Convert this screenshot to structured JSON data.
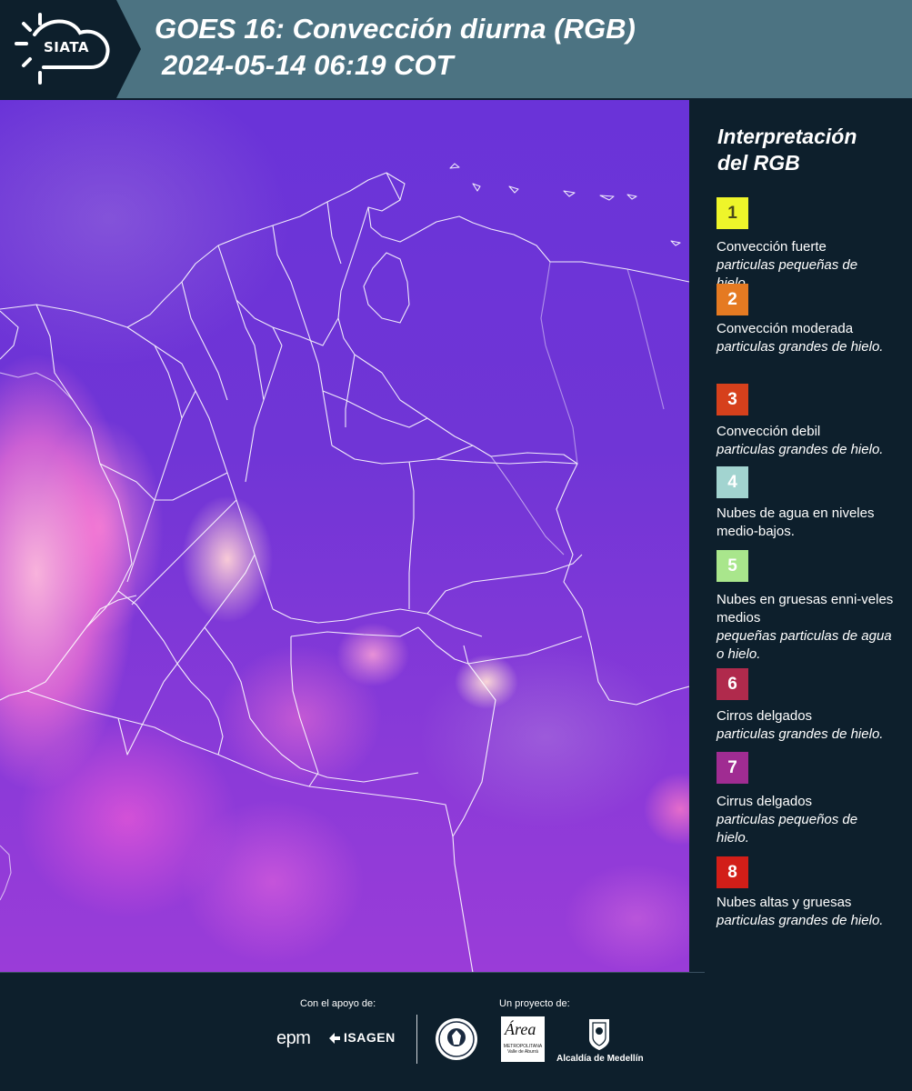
{
  "header": {
    "logo_text": "SIATA",
    "title_line1": "GOES 16: Convección diurna (RGB)",
    "title_line2": "2024-05-14 06:19 COT"
  },
  "legend": {
    "title_line1": "Interpretación",
    "title_line2": "del RGB",
    "items": [
      {
        "number": "1",
        "color": "#eef52a",
        "text_color": "#4a4a1a",
        "label": "Convección fuerte",
        "detail": "particulas pequeñas de hielo."
      },
      {
        "number": "2",
        "color": "#e57a22",
        "text_color": "#ffffff",
        "label": "Convección moderada",
        "detail": "particulas grandes de hielo."
      },
      {
        "number": "3",
        "color": "#d6401c",
        "text_color": "#ffffff",
        "label": "Convección debil",
        "detail": "particulas grandes de hielo."
      },
      {
        "number": "4",
        "color": "#a2d4d0",
        "text_color": "#ffffff",
        "label": "Nubes de agua en niveles medio-bajos.",
        "detail": ""
      },
      {
        "number": "5",
        "color": "#a9e68c",
        "text_color": "#ffffff",
        "label": "Nubes en gruesas enni-veles medios",
        "detail": "pequeñas particulas de agua o hielo."
      },
      {
        "number": "6",
        "color": "#b02a4c",
        "text_color": "#ffffff",
        "label": "Cirros delgados",
        "detail": "particulas grandes de hielo."
      },
      {
        "number": "7",
        "color": "#a02c92",
        "text_color": "#ffffff",
        "label": "Cirrus delgados",
        "detail": "particulas pequeños de hielo."
      },
      {
        "number": "8",
        "color": "#d21e18",
        "text_color": "#ffffff",
        "label": "Nubes altas y gruesas",
        "detail": "particulas grandes de hielo."
      }
    ]
  },
  "footer": {
    "support_label": "Con el apoyo de:",
    "project_label": "Un proyecto de:",
    "sponsor1": "epm",
    "sponsor2": "ISAGEN",
    "partner1_text": "METROPOLITANA Valle de Aburrá",
    "partner1_script": "Área",
    "partner2": "Alcaldía de Medellín"
  }
}
